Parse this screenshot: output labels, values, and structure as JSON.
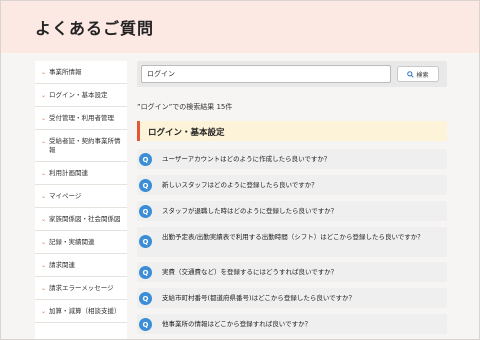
{
  "header": {
    "title": "よくあるご質問"
  },
  "sidebar": {
    "items": [
      {
        "label": "事業所情報"
      },
      {
        "label": "ログイン・基本設定"
      },
      {
        "label": "受付管理・利用者管理"
      },
      {
        "label": "受給者証・契約事業所情報"
      },
      {
        "label": "利用計画関連"
      },
      {
        "label": "マイページ"
      },
      {
        "label": "家族関係図・社会関係図"
      },
      {
        "label": "記録・実績関連"
      },
      {
        "label": "請求関連"
      },
      {
        "label": "請求エラーメッセージ"
      },
      {
        "label": "加算・減算（相談支援）"
      }
    ]
  },
  "search": {
    "value": "ログイン",
    "button_label": "検索"
  },
  "results": {
    "count_text": "”ログイン”での検索結果 15件",
    "section_title": "ログイン・基本設定",
    "q_mark": "Q",
    "items": [
      {
        "text": "ユーザーアカウントはどのように作成したら良いですか？"
      },
      {
        "text": "新しいスタッフはどのように登録したら良いですか？"
      },
      {
        "text": "スタッフが退職した時はどのように登録したら良いですか？"
      },
      {
        "text": "出勤予定表/出勤実績表で利用する出勤時間（シフト）はどこから登録したら良いですか？"
      },
      {
        "text": "実費（交通費など）を登録するにはどうすれば良いですか？"
      },
      {
        "text": "支給市町村番号(都道府県番号)はどこから登録したら良いですか？"
      },
      {
        "text": "他事業所の情報はどこから登録すれば良いですか？"
      }
    ]
  },
  "colors": {
    "accent": "#e0573a",
    "q_badge": "#3a8dd6",
    "header_bg": "#fde9e4",
    "section_bg": "#fdf3d8"
  }
}
